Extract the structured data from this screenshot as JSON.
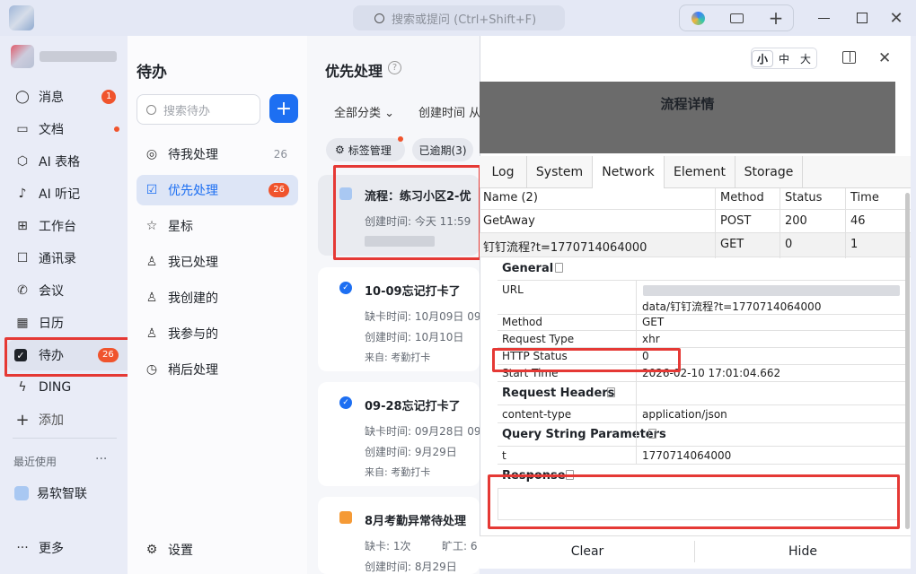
{
  "search": {
    "placeholder": "搜索或提问 (Ctrl+Shift+F)"
  },
  "nav": {
    "items": [
      {
        "label": "消息",
        "badge": "1"
      },
      {
        "label": "文档"
      },
      {
        "label": "AI 表格"
      },
      {
        "label": "AI 听记"
      },
      {
        "label": "工作台"
      },
      {
        "label": "通讯录"
      },
      {
        "label": "会议"
      },
      {
        "label": "日历"
      },
      {
        "label": "待办",
        "badge": "26"
      },
      {
        "label": "DING"
      },
      {
        "label": "添加"
      }
    ],
    "recent_title": "最近使用",
    "recent_more": "···",
    "recent_item": "易软智联",
    "more_label": "更多"
  },
  "todo": {
    "title": "待办",
    "search_placeholder": "搜索待办",
    "add_label": "+",
    "items": [
      {
        "label": "待我处理",
        "count": "26"
      },
      {
        "label": "优先处理",
        "badge": "26"
      },
      {
        "label": "星标"
      },
      {
        "label": "我已处理"
      },
      {
        "label": "我创建的"
      },
      {
        "label": "我参与的"
      },
      {
        "label": "稍后处理"
      }
    ],
    "settings_label": "设置"
  },
  "priority": {
    "title": "优先处理",
    "filter_category": "全部分类",
    "filter_time": "创建时间 从",
    "tag_manage": "标签管理",
    "overdue": "已逾期(3)",
    "cards": [
      {
        "title": "流程：练习小区2-优",
        "line1": "创建时间: 今天 11:59"
      },
      {
        "title": "10-09忘记打卡了",
        "line1": "缺卡时间: 10月09日 09",
        "line2": "创建时间: 10月10日",
        "line3": "来自: 考勤打卡"
      },
      {
        "title": "09-28忘记打卡了",
        "line1": "缺卡时间: 09月28日 09",
        "line2": "创建时间: 9月29日",
        "line3": "来自: 考勤打卡"
      },
      {
        "title": "8月考勤异常待处理",
        "line1": "缺卡: 1次",
        "line1b": "旷工: 6",
        "line2": "创建时间: 8月29日"
      }
    ]
  },
  "devtools": {
    "size_options": [
      "小",
      "中",
      "大"
    ],
    "header_title": "流程详情",
    "tabs": [
      "Log",
      "System",
      "Network",
      "Element",
      "Storage"
    ],
    "columns": [
      "Name (2)",
      "Method",
      "Status",
      "Time"
    ],
    "rows": [
      {
        "name": "GetAway",
        "method": "POST",
        "status": "200",
        "time": "46"
      },
      {
        "name": "钉钉流程?t=1770714064000",
        "method": "GET",
        "status": "0",
        "time": "1"
      }
    ],
    "general_title": "General",
    "general": [
      {
        "k": "URL",
        "v": "data/钉钉流程?t=1770714064000"
      },
      {
        "k": "Method",
        "v": "GET"
      },
      {
        "k": "Request Type",
        "v": "xhr"
      },
      {
        "k": "HTTP Status",
        "v": "0"
      },
      {
        "k": "Start Time",
        "v": "2026-02-10 17:01:04.662"
      }
    ],
    "req_headers_title": "Request Headers",
    "req_headers": [
      {
        "k": "content-type",
        "v": "application/json"
      }
    ],
    "query_title": "Query String Parameters",
    "query": [
      {
        "k": "t",
        "v": "1770714064000"
      }
    ],
    "response_title": "Response",
    "clear_label": "Clear",
    "hide_label": "Hide"
  }
}
